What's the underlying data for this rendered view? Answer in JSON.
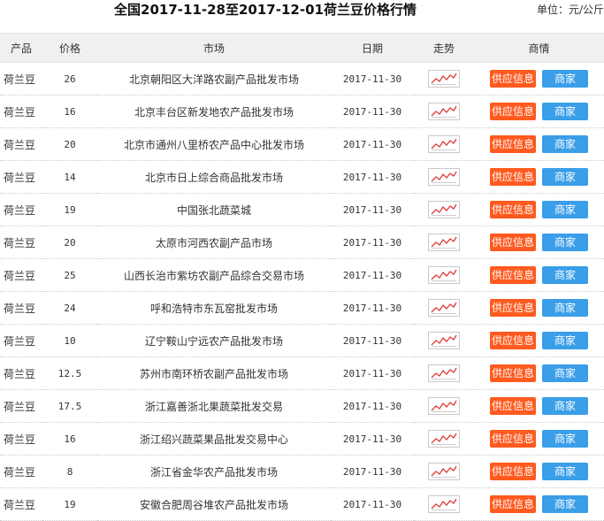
{
  "header": {
    "title": "全国2017-11-28至2017-12-01荷兰豆价格行情",
    "unit": "单位：元/公斤"
  },
  "columns": [
    "产品",
    "价格",
    "市场",
    "日期",
    "走势",
    "商情"
  ],
  "buttons": {
    "supply": "供应信息",
    "merchant": "商家"
  },
  "icons": {
    "trend": "trend-chart-icon"
  },
  "colors": {
    "supply_button": "#ff5a1f",
    "merchant_button": "#3a9ee8",
    "trend_line": "#e03a3a"
  },
  "rows": [
    {
      "product": "荷兰豆",
      "price": "26",
      "market": "北京朝阳区大洋路农副产品批发市场",
      "date": "2017-11-30"
    },
    {
      "product": "荷兰豆",
      "price": "16",
      "market": "北京丰台区新发地农产品批发市场",
      "date": "2017-11-30"
    },
    {
      "product": "荷兰豆",
      "price": "20",
      "market": "北京市通州八里桥农产品中心批发市场",
      "date": "2017-11-30"
    },
    {
      "product": "荷兰豆",
      "price": "14",
      "market": "北京市日上综合商品批发市场",
      "date": "2017-11-30"
    },
    {
      "product": "荷兰豆",
      "price": "19",
      "market": "中国张北蔬菜城",
      "date": "2017-11-30"
    },
    {
      "product": "荷兰豆",
      "price": "20",
      "market": "太原市河西农副产品市场",
      "date": "2017-11-30"
    },
    {
      "product": "荷兰豆",
      "price": "25",
      "market": "山西长治市紫坊农副产品综合交易市场",
      "date": "2017-11-30"
    },
    {
      "product": "荷兰豆",
      "price": "24",
      "market": "呼和浩特市东瓦窑批发市场",
      "date": "2017-11-30"
    },
    {
      "product": "荷兰豆",
      "price": "10",
      "market": "辽宁鞍山宁远农产品批发市场",
      "date": "2017-11-30"
    },
    {
      "product": "荷兰豆",
      "price": "12.5",
      "market": "苏州市南环桥农副产品批发市场",
      "date": "2017-11-30"
    },
    {
      "product": "荷兰豆",
      "price": "17.5",
      "market": "浙江嘉善浙北果蔬菜批发交易",
      "date": "2017-11-30"
    },
    {
      "product": "荷兰豆",
      "price": "16",
      "market": "浙江绍兴蔬菜果品批发交易中心",
      "date": "2017-11-30"
    },
    {
      "product": "荷兰豆",
      "price": "8",
      "market": "浙江省金华农产品批发市场",
      "date": "2017-11-30"
    },
    {
      "product": "荷兰豆",
      "price": "19",
      "market": "安徽合肥周谷堆农产品批发市场",
      "date": "2017-11-30"
    }
  ]
}
